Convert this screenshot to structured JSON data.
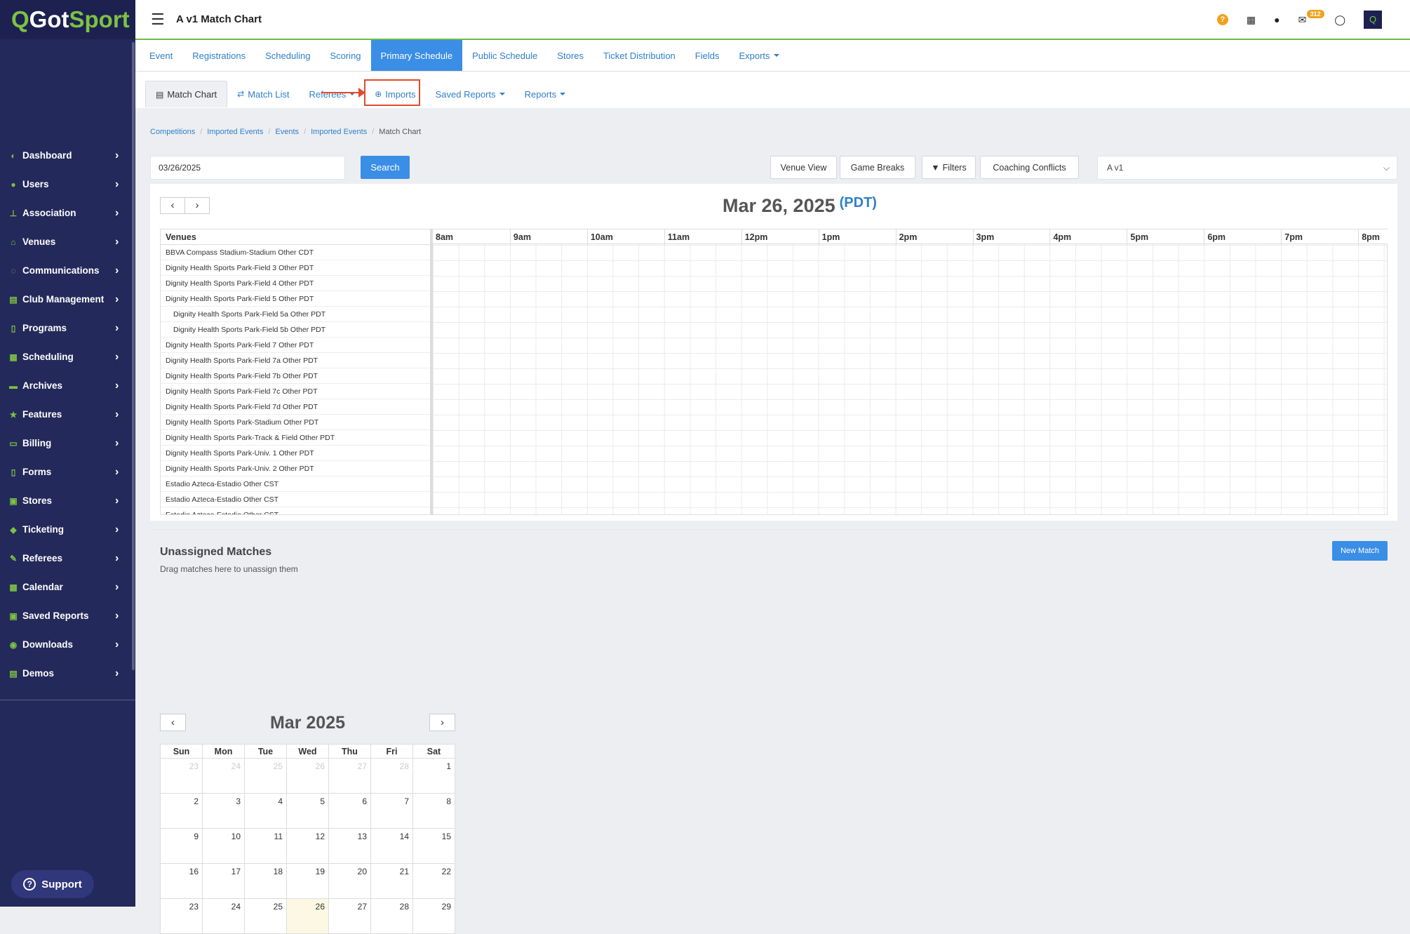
{
  "app": {
    "logo_got": "Got",
    "logo_sport": "Sport"
  },
  "sidebar": {
    "items": [
      {
        "label": "Dashboard",
        "icon": "dashboard-icon",
        "glyph": "◐"
      },
      {
        "label": "Users",
        "icon": "users-icon",
        "glyph": "●"
      },
      {
        "label": "Association",
        "icon": "sitemap-icon",
        "glyph": "⊥"
      },
      {
        "label": "Venues",
        "icon": "home-icon",
        "glyph": "⌂"
      },
      {
        "label": "Communications",
        "icon": "comments-icon",
        "glyph": "◌"
      },
      {
        "label": "Club Management",
        "icon": "list-icon",
        "glyph": "▤"
      },
      {
        "label": "Programs",
        "icon": "file-icon",
        "glyph": "▯"
      },
      {
        "label": "Scheduling",
        "icon": "calendar-list-icon",
        "glyph": "▦"
      },
      {
        "label": "Archives",
        "icon": "archive-icon",
        "glyph": "▬"
      },
      {
        "label": "Features",
        "icon": "star-icon",
        "glyph": "★"
      },
      {
        "label": "Billing",
        "icon": "credit-card-icon",
        "glyph": "▭"
      },
      {
        "label": "Forms",
        "icon": "form-icon",
        "glyph": "▯"
      },
      {
        "label": "Stores",
        "icon": "store-icon",
        "glyph": "▣"
      },
      {
        "label": "Ticketing",
        "icon": "ticket-icon",
        "glyph": "◆"
      },
      {
        "label": "Referees",
        "icon": "gavel-icon",
        "glyph": "✎"
      },
      {
        "label": "Calendar",
        "icon": "calendar-icon",
        "glyph": "▦"
      },
      {
        "label": "Saved Reports",
        "icon": "save-icon",
        "glyph": "▣"
      },
      {
        "label": "Downloads",
        "icon": "download-icon",
        "glyph": "◉"
      },
      {
        "label": "Demos",
        "icon": "document-icon",
        "glyph": "▤"
      }
    ],
    "support": "Support"
  },
  "topbar": {
    "title": "A v1 Match Chart",
    "mail_badge": "312"
  },
  "tabs1": [
    {
      "label": "Event",
      "active": false
    },
    {
      "label": "Registrations",
      "active": false
    },
    {
      "label": "Scheduling",
      "active": false
    },
    {
      "label": "Scoring",
      "active": false
    },
    {
      "label": "Primary Schedule",
      "active": true
    },
    {
      "label": "Public Schedule",
      "active": false
    },
    {
      "label": "Stores",
      "active": false
    },
    {
      "label": "Ticket Distribution",
      "active": false
    },
    {
      "label": "Fields",
      "active": false
    },
    {
      "label": "Exports",
      "active": false,
      "dropdown": true
    }
  ],
  "tabs2": [
    {
      "label": "Match Chart",
      "active": true,
      "glyph": "▤",
      "icon": "table-icon"
    },
    {
      "label": "Match List",
      "active": false,
      "glyph": "⇄",
      "icon": "exchange-icon"
    },
    {
      "label": "Referees",
      "active": false,
      "dropdown": true
    },
    {
      "label": "Imports",
      "active": false,
      "glyph": "⊕",
      "icon": "import-icon"
    },
    {
      "label": "Saved Reports",
      "active": false,
      "dropdown": true
    },
    {
      "label": "Reports",
      "active": false,
      "dropdown": true
    }
  ],
  "breadcrumb": [
    "Competitions",
    "Imported Events",
    "Events",
    "Imported Events",
    "Match Chart"
  ],
  "toolbar": {
    "date": "03/26/2025",
    "search": "Search",
    "venue_view": "Venue View",
    "game_breaks": "Game Breaks",
    "filters": "Filters",
    "coaching_conflicts": "Coaching Conflicts",
    "division": "A v1"
  },
  "chart": {
    "date": "Mar 26, 2025",
    "tz": "(PDT)",
    "venues_header": "Venues",
    "hours": [
      "8am",
      "9am",
      "10am",
      "11am",
      "12pm",
      "1pm",
      "2pm",
      "3pm",
      "4pm",
      "5pm",
      "6pm",
      "7pm",
      "8pm"
    ],
    "venues": [
      {
        "name": "BBVA Compass Stadium-Stadium Other CDT",
        "sub": false
      },
      {
        "name": "Dignity Health Sports Park-Field 3 Other PDT",
        "sub": false
      },
      {
        "name": "Dignity Health Sports Park-Field 4 Other PDT",
        "sub": false
      },
      {
        "name": "Dignity Health Sports Park-Field 5 Other PDT",
        "sub": false
      },
      {
        "name": "Dignity Health Sports Park-Field 5a Other PDT",
        "sub": true
      },
      {
        "name": "Dignity Health Sports Park-Field 5b Other PDT",
        "sub": true
      },
      {
        "name": "Dignity Health Sports Park-Field 7 Other PDT",
        "sub": false
      },
      {
        "name": "Dignity Health Sports Park-Field 7a Other PDT",
        "sub": false
      },
      {
        "name": "Dignity Health Sports Park-Field 7b Other PDT",
        "sub": false
      },
      {
        "name": "Dignity Health Sports Park-Field 7c Other PDT",
        "sub": false
      },
      {
        "name": "Dignity Health Sports Park-Field 7d Other PDT",
        "sub": false
      },
      {
        "name": "Dignity Health Sports Park-Stadium Other PDT",
        "sub": false
      },
      {
        "name": "Dignity Health Sports Park-Track & Field Other PDT",
        "sub": false
      },
      {
        "name": "Dignity Health Sports Park-Univ. 1 Other PDT",
        "sub": false
      },
      {
        "name": "Dignity Health Sports Park-Univ. 2 Other PDT",
        "sub": false
      },
      {
        "name": "Estadio Azteca-Estadio Other CST",
        "sub": false
      },
      {
        "name": "Estadio Azteca-Estadio Other CST",
        "sub": false
      },
      {
        "name": "Estadio Azteca-Estadio Other CST",
        "sub": false
      }
    ]
  },
  "unassigned": {
    "title": "Unassigned Matches",
    "desc": "Drag matches here to unassign them",
    "new_match": "New Match"
  },
  "calendar": {
    "title": "Mar 2025",
    "days": [
      "Sun",
      "Mon",
      "Tue",
      "Wed",
      "Thu",
      "Fri",
      "Sat"
    ],
    "weeks": [
      [
        {
          "d": "23",
          "m": true
        },
        {
          "d": "24",
          "m": true
        },
        {
          "d": "25",
          "m": true
        },
        {
          "d": "26",
          "m": true
        },
        {
          "d": "27",
          "m": true
        },
        {
          "d": "28",
          "m": true
        },
        {
          "d": "1"
        }
      ],
      [
        {
          "d": "2"
        },
        {
          "d": "3"
        },
        {
          "d": "4"
        },
        {
          "d": "5"
        },
        {
          "d": "6"
        },
        {
          "d": "7"
        },
        {
          "d": "8"
        }
      ],
      [
        {
          "d": "9"
        },
        {
          "d": "10"
        },
        {
          "d": "11"
        },
        {
          "d": "12"
        },
        {
          "d": "13"
        },
        {
          "d": "14"
        },
        {
          "d": "15"
        }
      ],
      [
        {
          "d": "16"
        },
        {
          "d": "17"
        },
        {
          "d": "18"
        },
        {
          "d": "19"
        },
        {
          "d": "20"
        },
        {
          "d": "21"
        },
        {
          "d": "22"
        }
      ],
      [
        {
          "d": "23"
        },
        {
          "d": "24"
        },
        {
          "d": "25"
        },
        {
          "d": "26",
          "today": true
        },
        {
          "d": "27"
        },
        {
          "d": "28"
        },
        {
          "d": "29"
        }
      ]
    ]
  },
  "colors": {
    "brand_navy": "#24295b",
    "accent_blue": "#3a8ee6",
    "accent_green": "#7dc242",
    "highlight_red": "#e34a2f",
    "badge_orange": "#f0a21e"
  }
}
